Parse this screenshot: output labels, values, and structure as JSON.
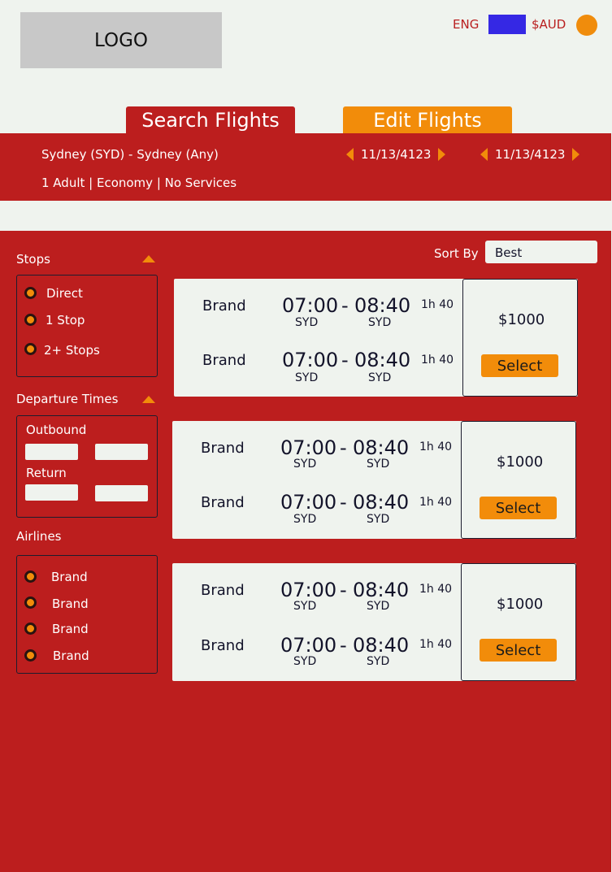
{
  "header": {
    "logo": "LOGO",
    "language": "ENG",
    "currency": "$AUD",
    "colors": {
      "language_swatch": "#3528e4",
      "user_circle": "#f08c0c"
    }
  },
  "tabs": [
    {
      "label": "Search Flights",
      "color": "#bc1e1e"
    },
    {
      "label": "Edit Flights",
      "color": "#f28c0a"
    }
  ],
  "summary": {
    "route": "Sydney (SYD) - Sydney (Any)",
    "passengers": "1 Adult | Economy |  No Services",
    "outbound_date": "11/13/4123",
    "return_date": "11/13/4123"
  },
  "sort": {
    "label": "Sort By",
    "value": "Best"
  },
  "filters": {
    "stops": {
      "title": "Stops",
      "options": [
        "Direct",
        "1 Stop",
        "2+ Stops"
      ]
    },
    "departure_times": {
      "title": "Departure Times",
      "outbound_label": "Outbound",
      "return_label": "Return"
    },
    "airlines": {
      "title": "Airlines",
      "options": [
        "Brand",
        "Brand",
        "Brand",
        "Brand"
      ]
    }
  },
  "results": [
    {
      "legs": [
        {
          "brand": "Brand",
          "depart": "07:00",
          "arrive": "08:40",
          "from": "SYD",
          "to": "SYD",
          "duration": "1h 40"
        },
        {
          "brand": "Brand",
          "depart": "07:00",
          "arrive": "08:40",
          "from": "SYD",
          "to": "SYD",
          "duration": "1h 40"
        }
      ],
      "price": "$1000",
      "select_label": "Select"
    },
    {
      "legs": [
        {
          "brand": "Brand",
          "depart": "07:00",
          "arrive": "08:40",
          "from": "SYD",
          "to": "SYD",
          "duration": "1h 40"
        },
        {
          "brand": "Brand",
          "depart": "07:00",
          "arrive": "08:40",
          "from": "SYD",
          "to": "SYD",
          "duration": "1h 40"
        }
      ],
      "price": "$1000",
      "select_label": "Select"
    },
    {
      "legs": [
        {
          "brand": "Brand",
          "depart": "07:00",
          "arrive": "08:40",
          "from": "SYD",
          "to": "SYD",
          "duration": "1h 40"
        },
        {
          "brand": "Brand",
          "depart": "07:00",
          "arrive": "08:40",
          "from": "SYD",
          "to": "SYD",
          "duration": "1h 40"
        }
      ],
      "price": "$1000",
      "select_label": "Select"
    }
  ],
  "colors": {
    "primary": "#bc1e1e",
    "accent": "#f28c0a",
    "background": "#eff3ee"
  }
}
